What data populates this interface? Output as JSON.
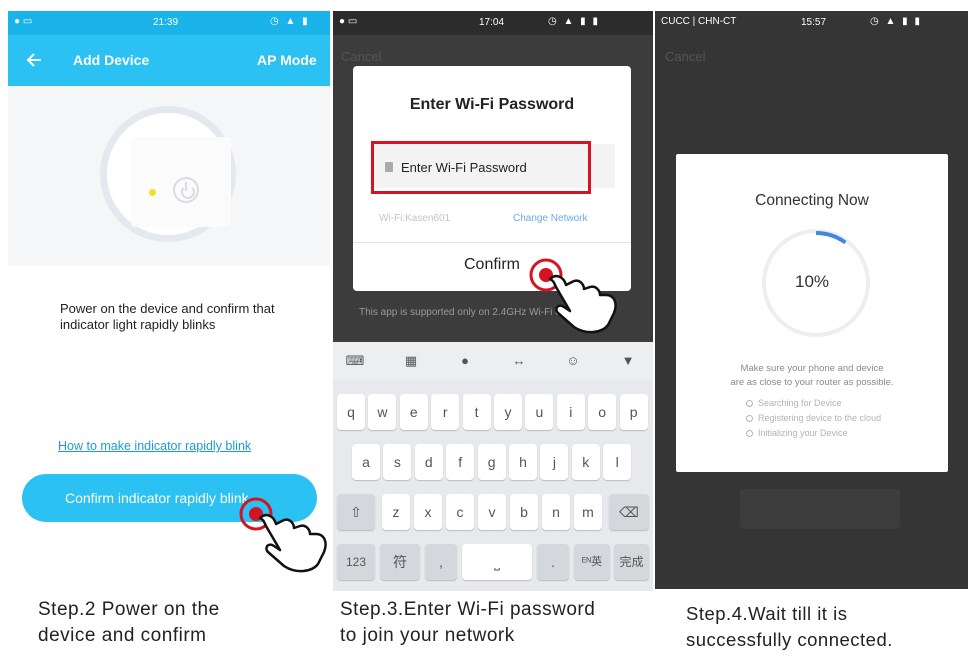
{
  "panel1": {
    "status": {
      "left": "● ▭",
      "time": "21:39",
      "right": "◷ ▲ ▮"
    },
    "appbar": {
      "back_icon": "back-arrow-icon",
      "title": "Add Device",
      "action": "AP Mode"
    },
    "instruction": "Power on the device and confirm that indicator light rapidly blinks",
    "help_link": "How to make indicator rapidly blink",
    "confirm_button": "Confirm indicator rapidly blink"
  },
  "panel2": {
    "status": {
      "left": "● ▭",
      "time": "17:04",
      "right": "◷ ▲ ▮ ▮"
    },
    "cancel": "Cancel",
    "dialog": {
      "title": "Enter Wi-Fi Password",
      "password_placeholder": "Enter Wi-Fi Password",
      "wifi_label": "Wi-Fi:Kasen601",
      "change_network": "Change Network",
      "confirm": "Confirm"
    },
    "notice": "This app is supported only on 2.4GHz Wi-Fi channel",
    "keyboard": {
      "row1": [
        "q",
        "w",
        "e",
        "r",
        "t",
        "y",
        "u",
        "i",
        "o",
        "p"
      ],
      "row2": [
        "a",
        "s",
        "d",
        "f",
        "g",
        "h",
        "j",
        "k",
        "l"
      ],
      "row3": [
        "z",
        "x",
        "c",
        "v",
        "b",
        "n",
        "m"
      ],
      "numbers_key": "123",
      "symbol_key": "符",
      "comma_key": ",",
      "period_key": ".",
      "lang_key": "ᴱᴺ英",
      "done_key": "完成"
    }
  },
  "panel3": {
    "status": {
      "left": "CUCC | CHN-CT",
      "time": "15:57",
      "right": "◷ ▲ ▮ ▮"
    },
    "cancel": "Cancel",
    "dialog": {
      "title": "Connecting Now",
      "progress": "10%",
      "progress_value": 0.1,
      "hint_line1": "Make sure your phone and device",
      "hint_line2": "are as close to your router as possible.",
      "steps": [
        "Searching for Device",
        "Registering device to the cloud",
        "Initializing your Device"
      ]
    }
  },
  "captions": {
    "step2_line1": "Step.2 Power on the",
    "step2_line2": "device and confirm",
    "step3_line1": "Step.3.Enter Wi-Fi password",
    "step3_line2": "to  join your network",
    "step4_line1": "Step.4.Wait till it is",
    "step4_line2": "successfully connected."
  },
  "colors": {
    "accent": "#2bc1f3",
    "highlight_red": "#d41423",
    "dark_bg": "#3c3c3c",
    "progress_blue": "#3f86e8"
  }
}
